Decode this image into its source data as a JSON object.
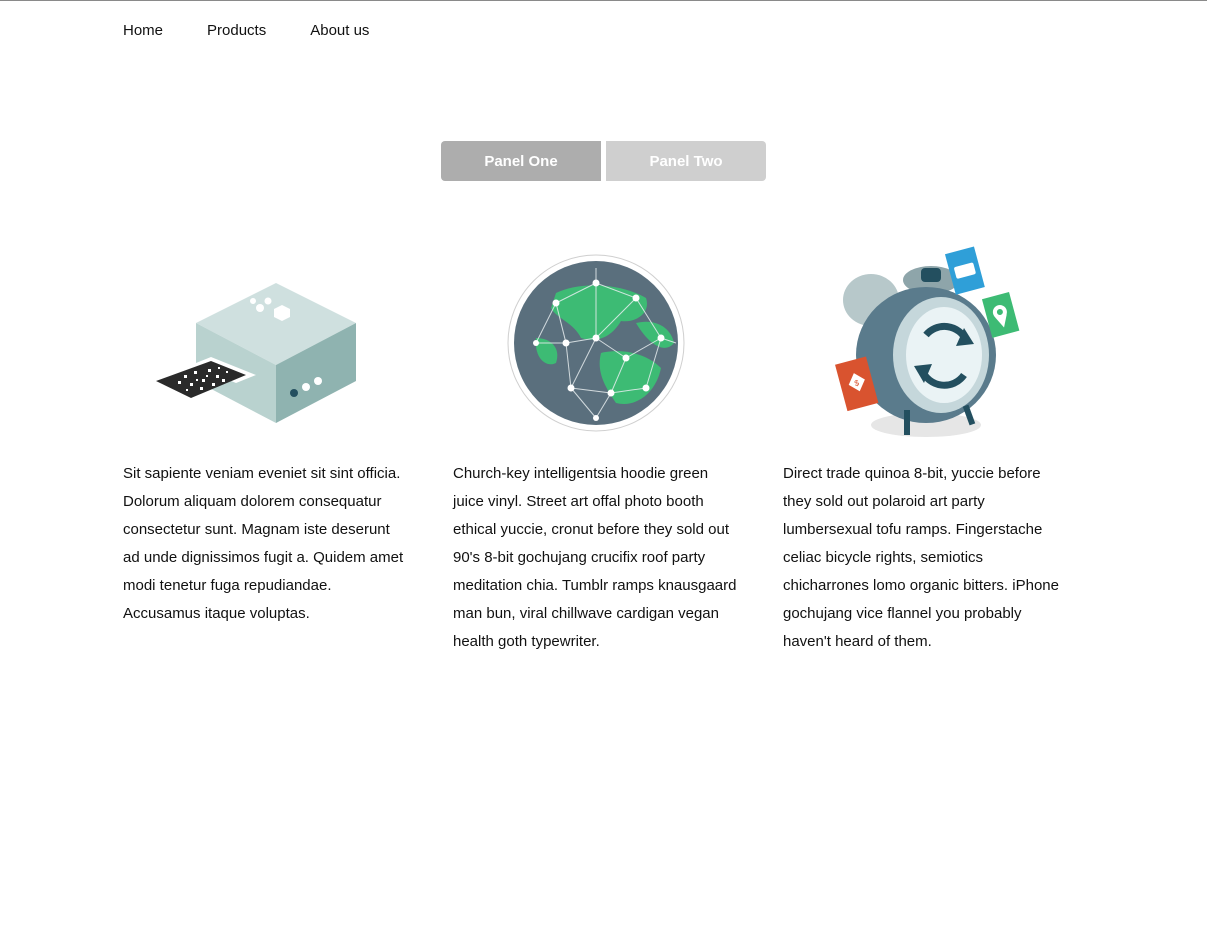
{
  "nav": {
    "items": [
      {
        "label": "Home"
      },
      {
        "label": "Products"
      },
      {
        "label": "About us"
      }
    ]
  },
  "tabs": [
    {
      "label": "Panel One",
      "active": true,
      "color": "#adadad"
    },
    {
      "label": "Panel Two",
      "active": false,
      "color": "#cfcfcf"
    }
  ],
  "features": [
    {
      "icon": "qr-printer-box-icon",
      "text": "Sit sapiente veniam eveniet sit sint officia. Dolorum aliquam dolorem consequatur consectetur sunt. Magnam iste deserunt ad unde dignissimos fugit a. Quidem amet modi tenetur fuga repudiandae. Accusamus itaque voluptas."
    },
    {
      "icon": "network-globe-icon",
      "text": "Church-key intelligentsia hoodie green juice vinyl. Street art offal photo booth ethical yuccie, cronut before they sold out 90's 8-bit gochujang crucifix roof party meditation chia. Tumblr ramps knausgaard man bun, viral chillwave cardigan vegan health goth typewriter."
    },
    {
      "icon": "alarm-clock-sync-icon",
      "text": "Direct trade quinoa 8-bit, yuccie before they sold out polaroid art party lumbersexual tofu ramps. Fingerstache celiac bicycle rights, semiotics chicharrones lomo organic bitters. iPhone gochujang vice flannel you probably haven't heard of them."
    }
  ],
  "colors": {
    "accent_green": "#3dbb74",
    "slate": "#5a6f7d",
    "tab_active": "#adadad",
    "tab_inactive": "#cfcfcf"
  }
}
